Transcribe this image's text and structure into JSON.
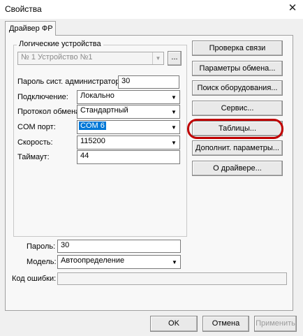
{
  "window": {
    "title": "Свойства",
    "close_glyph": "✕"
  },
  "tab": {
    "label": "Драйвер ФР"
  },
  "group": {
    "legend": "Логические устройства"
  },
  "device": {
    "value": "№ 1 Устройство №1",
    "browse_label": "..."
  },
  "fields": {
    "admin_password": {
      "label": "Пароль сист. администратора:",
      "value": "30"
    },
    "connection": {
      "label": "Подключение:",
      "value": "Локально"
    },
    "protocol": {
      "label": "Протокол обмена:",
      "value": "Стандартный"
    },
    "com_port": {
      "label": "COM порт:",
      "value": "COM 6"
    },
    "speed": {
      "label": "Скорость:",
      "value": "115200"
    },
    "timeout": {
      "label": "Таймаут:",
      "value": "44"
    },
    "password": {
      "label": "Пароль:",
      "value": "30"
    },
    "model": {
      "label": "Модель:",
      "value": "Автоопределение"
    },
    "error_code": {
      "label": "Код ошибки:",
      "value": ""
    }
  },
  "buttons": {
    "check_connection": "Проверка связи",
    "exchange_params": "Параметры обмена...",
    "search_hardware": "Поиск оборудования...",
    "service": "Сервис...",
    "tables": "Таблицы...",
    "extra_params": "Дополнит. параметры...",
    "about": "О драйвере...",
    "ok": "OK",
    "cancel": "Отмена",
    "apply": "Применить"
  },
  "icons": {
    "dropdown": "chevron-down-icon",
    "close": "close-icon"
  },
  "colors": {
    "selection": "#0078d7",
    "highlight": "#c00000"
  }
}
